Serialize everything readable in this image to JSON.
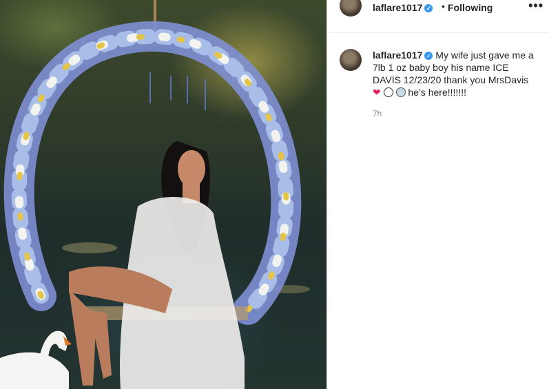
{
  "post": {
    "author": "laflare1017",
    "header_separator": "•",
    "follow_status": "Following",
    "more_label": "•••",
    "caption": {
      "username": "laflare1017",
      "text_before_emoji": "My wife just gave me a 7lb 1 oz baby boy his name ICE DAVIS 12/23/20 thank you MrsDavis",
      "emoji_1": "heart",
      "emoji_2": "no-symbol",
      "emoji_3": "cold-face",
      "text_after_emoji": "he’s here!!!!!!!"
    },
    "time_ago": "7h"
  },
  "colors": {
    "verified_badge": "#3897f0",
    "text_primary": "#262626",
    "text_secondary": "#8e8e8e",
    "heart": "#e0245e"
  }
}
